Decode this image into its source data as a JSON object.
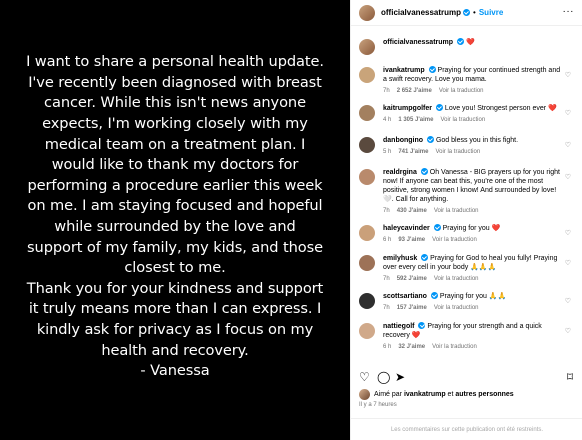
{
  "post": {
    "text": "I want to share a personal health update.\nI've recently been diagnosed with breast cancer. While this isn't news anyone expects, I'm working closely with my medical team on a treatment plan. I would like to thank my doctors for performing a procedure earlier this week on me. I am staying focused and hopeful while surrounded by the love and support of my family, my kids, and those closest to me.\nThank you for your kindness and support it truly means more than I can express. I kindly ask for privacy as I focus on my health and recovery.\n- Vanessa"
  },
  "header": {
    "username": "officialvanessatrump",
    "separator": "•",
    "follow_label": "Suivre",
    "more": "···"
  },
  "caption": {
    "username": "officialvanessatrump",
    "text": "❤️"
  },
  "comments": [
    {
      "user": "ivankatrump",
      "verified": true,
      "text": "Praying for your continued strength and a swift recovery. Love you mama.",
      "time": "7h",
      "likes": "2 652 J'aime",
      "reply": "Répondre",
      "translate": "Voir la traduction",
      "avatar_color": "#c9a47a"
    },
    {
      "user": "kaitrumpgolfer",
      "verified": true,
      "text": "Love you! Strongest person ever ❤️",
      "time": "4 h",
      "likes": "1 305 J'aime",
      "reply": "Répondre",
      "translate": "Voir la traduction",
      "avatar_color": "#a3805f"
    },
    {
      "user": "danbongino",
      "verified": true,
      "text": "God bless you in this fight.",
      "time": "5 h",
      "likes": "741 J'aime",
      "reply": "Répondre",
      "translate": "Voir la traduction",
      "avatar_color": "#5a4a3e"
    },
    {
      "user": "realdrgina",
      "verified": true,
      "text": "Oh Vanessa - BIG prayers up for you right now! If anyone can beat this, you're one of the most positive, strong women I know! And surrounded by love! 🤍. Call for anything.",
      "time": "7h",
      "likes": "430 J'aime",
      "reply": "Répondre",
      "translate": "Voir la traduction",
      "avatar_color": "#b98a6c"
    },
    {
      "user": "haleycavinder",
      "verified": true,
      "text": "Praying for you ❤️",
      "time": "6 h",
      "likes": "93 J'aime",
      "reply": "Répondre",
      "translate": "Voir la traduction",
      "avatar_color": "#caa07a"
    },
    {
      "user": "emilyhusk",
      "verified": true,
      "text": "Praying for God to heal you fully! Praying over every cell in your body 🙏🙏🙏",
      "time": "7h",
      "likes": "592 J'aime",
      "reply": "Répondre",
      "translate": "Voir la traduction",
      "avatar_color": "#9d7257"
    },
    {
      "user": "scottsartiano",
      "verified": true,
      "text": "Praying for you 🙏🙏",
      "time": "7h",
      "likes": "157 J'aime",
      "reply": "Répondre",
      "translate": "Voir la traduction",
      "avatar_color": "#2f2f2f"
    },
    {
      "user": "nattiegolf",
      "verified": true,
      "text": "Praying for your strength and a quick recovery ❤️",
      "time": "6 h",
      "likes": "32 J'aime",
      "reply": "Répondre",
      "translate": "Voir la traduction",
      "avatar_color": "#d0a98a"
    }
  ],
  "actions": {
    "like_icon": "heart-outline-icon",
    "comment_icon": "comment-icon",
    "share_icon": "send-icon",
    "save_icon": "bookmark-icon"
  },
  "likes_summary": {
    "prefix": "Aimé par",
    "user": "ivankatrump",
    "middle": "et",
    "others": "autres personnes"
  },
  "timestamp": "Il y a 7 heures",
  "comments_limited": "Les commentaires sur cette publication ont été restreints.",
  "colors": {
    "accent": "#0095f6",
    "muted": "#737373",
    "media_bg": "#000000"
  }
}
